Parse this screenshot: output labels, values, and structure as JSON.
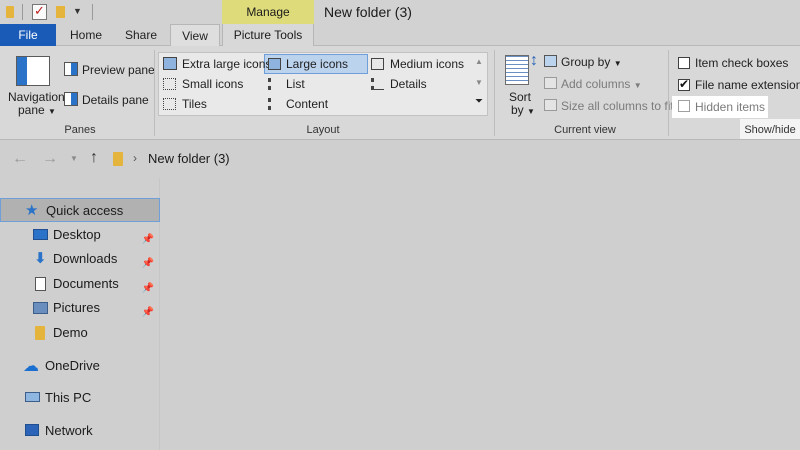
{
  "window": {
    "title": "New folder (3)"
  },
  "contextual_tab": {
    "label": "Manage",
    "sub_label": "Picture Tools"
  },
  "tabs": [
    {
      "label": "File"
    },
    {
      "label": "Home"
    },
    {
      "label": "Share"
    },
    {
      "label": "View"
    }
  ],
  "panes": {
    "navigation_pane_line1": "Navigation",
    "navigation_pane_line2": "pane",
    "preview_pane": "Preview pane",
    "details_pane": "Details pane",
    "group_label": "Panes"
  },
  "layout": {
    "items": [
      "Extra large icons",
      "Large icons",
      "Medium icons",
      "Small icons",
      "List",
      "Details",
      "Tiles",
      "Content"
    ],
    "selected": "Large icons",
    "group_label": "Layout"
  },
  "current_view": {
    "sort_line1": "Sort",
    "sort_line2": "by",
    "group_by": "Group by",
    "add_columns": "Add columns",
    "size_all": "Size all columns to fit",
    "group_label": "Current view"
  },
  "show_hide": {
    "item_check_boxes": {
      "label": "Item check boxes",
      "checked": false
    },
    "file_name_extensions": {
      "label": "File name extensions",
      "checked": true
    },
    "hidden_items": {
      "label": "Hidden items",
      "checked": false
    },
    "group_label": "Show/hide"
  },
  "address": {
    "path": "New folder (3)"
  },
  "nav_pane": {
    "items": [
      {
        "label": "Quick access",
        "icon": "star-icon",
        "pinned": false
      },
      {
        "label": "Desktop",
        "icon": "desktop-icon",
        "pinned": true
      },
      {
        "label": "Downloads",
        "icon": "download-icon",
        "pinned": true
      },
      {
        "label": "Documents",
        "icon": "documents-icon",
        "pinned": true
      },
      {
        "label": "Pictures",
        "icon": "pictures-icon",
        "pinned": true
      },
      {
        "label": "Demo",
        "icon": "folder-icon",
        "pinned": false
      },
      {
        "label": "OneDrive",
        "icon": "cloud-icon",
        "pinned": false
      },
      {
        "label": "This PC",
        "icon": "computer-icon",
        "pinned": false
      },
      {
        "label": "Network",
        "icon": "network-icon",
        "pinned": false
      }
    ]
  },
  "colors": {
    "file_tab": "#1a5bb7",
    "manage_tab": "#dedb7a",
    "selection": "#bcd3ee"
  }
}
